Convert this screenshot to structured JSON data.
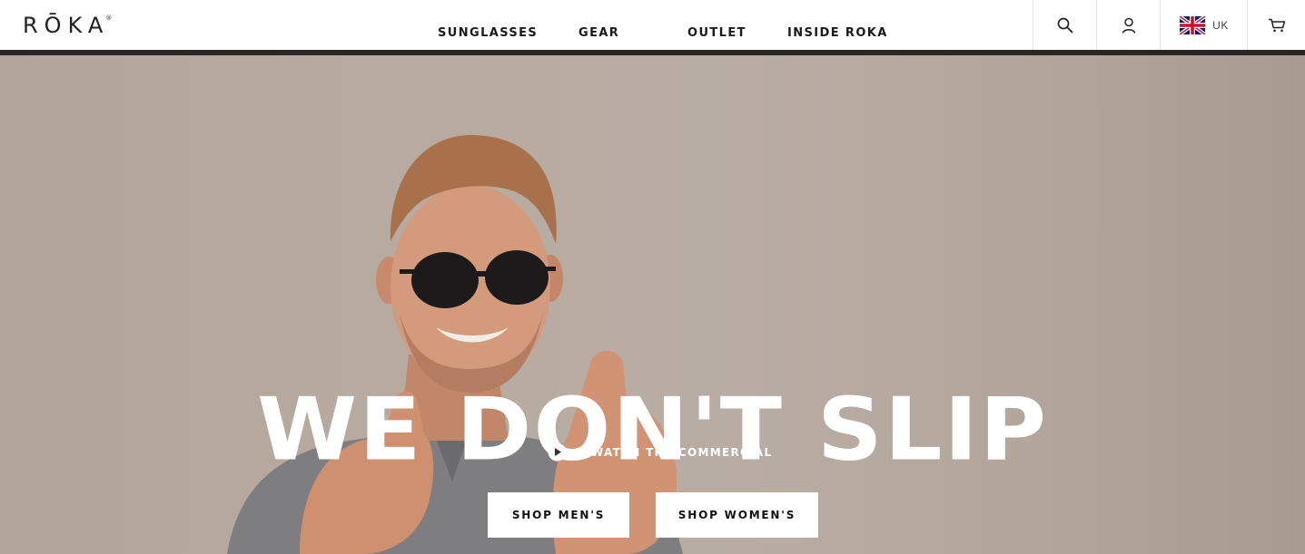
{
  "brand": {
    "logo_text": "RŌKA",
    "logo_mark": "®"
  },
  "nav": {
    "items": [
      {
        "label": "SUNGLASSES"
      },
      {
        "label": "GEAR"
      },
      {
        "label": "OUTLET"
      },
      {
        "label": "INSIDE ROKA"
      }
    ]
  },
  "utility": {
    "search_icon": "search-icon",
    "account_icon": "user-icon",
    "locale_flag": "uk-flag-icon",
    "locale_label": "UK",
    "cart_icon": "cart-icon"
  },
  "hero": {
    "title": "WE DON'T SLIP",
    "watch_label": "WATCH THE COMMERCIAL",
    "watch_icon": "play-icon",
    "shop_men_label": "SHOP MEN'S",
    "shop_women_label": "SHOP WOMEN'S"
  },
  "colors": {
    "header_rule": "#2a2626",
    "hero_bg": "#b7aaa0",
    "text_dark": "#1a1a1a",
    "white": "#ffffff"
  }
}
